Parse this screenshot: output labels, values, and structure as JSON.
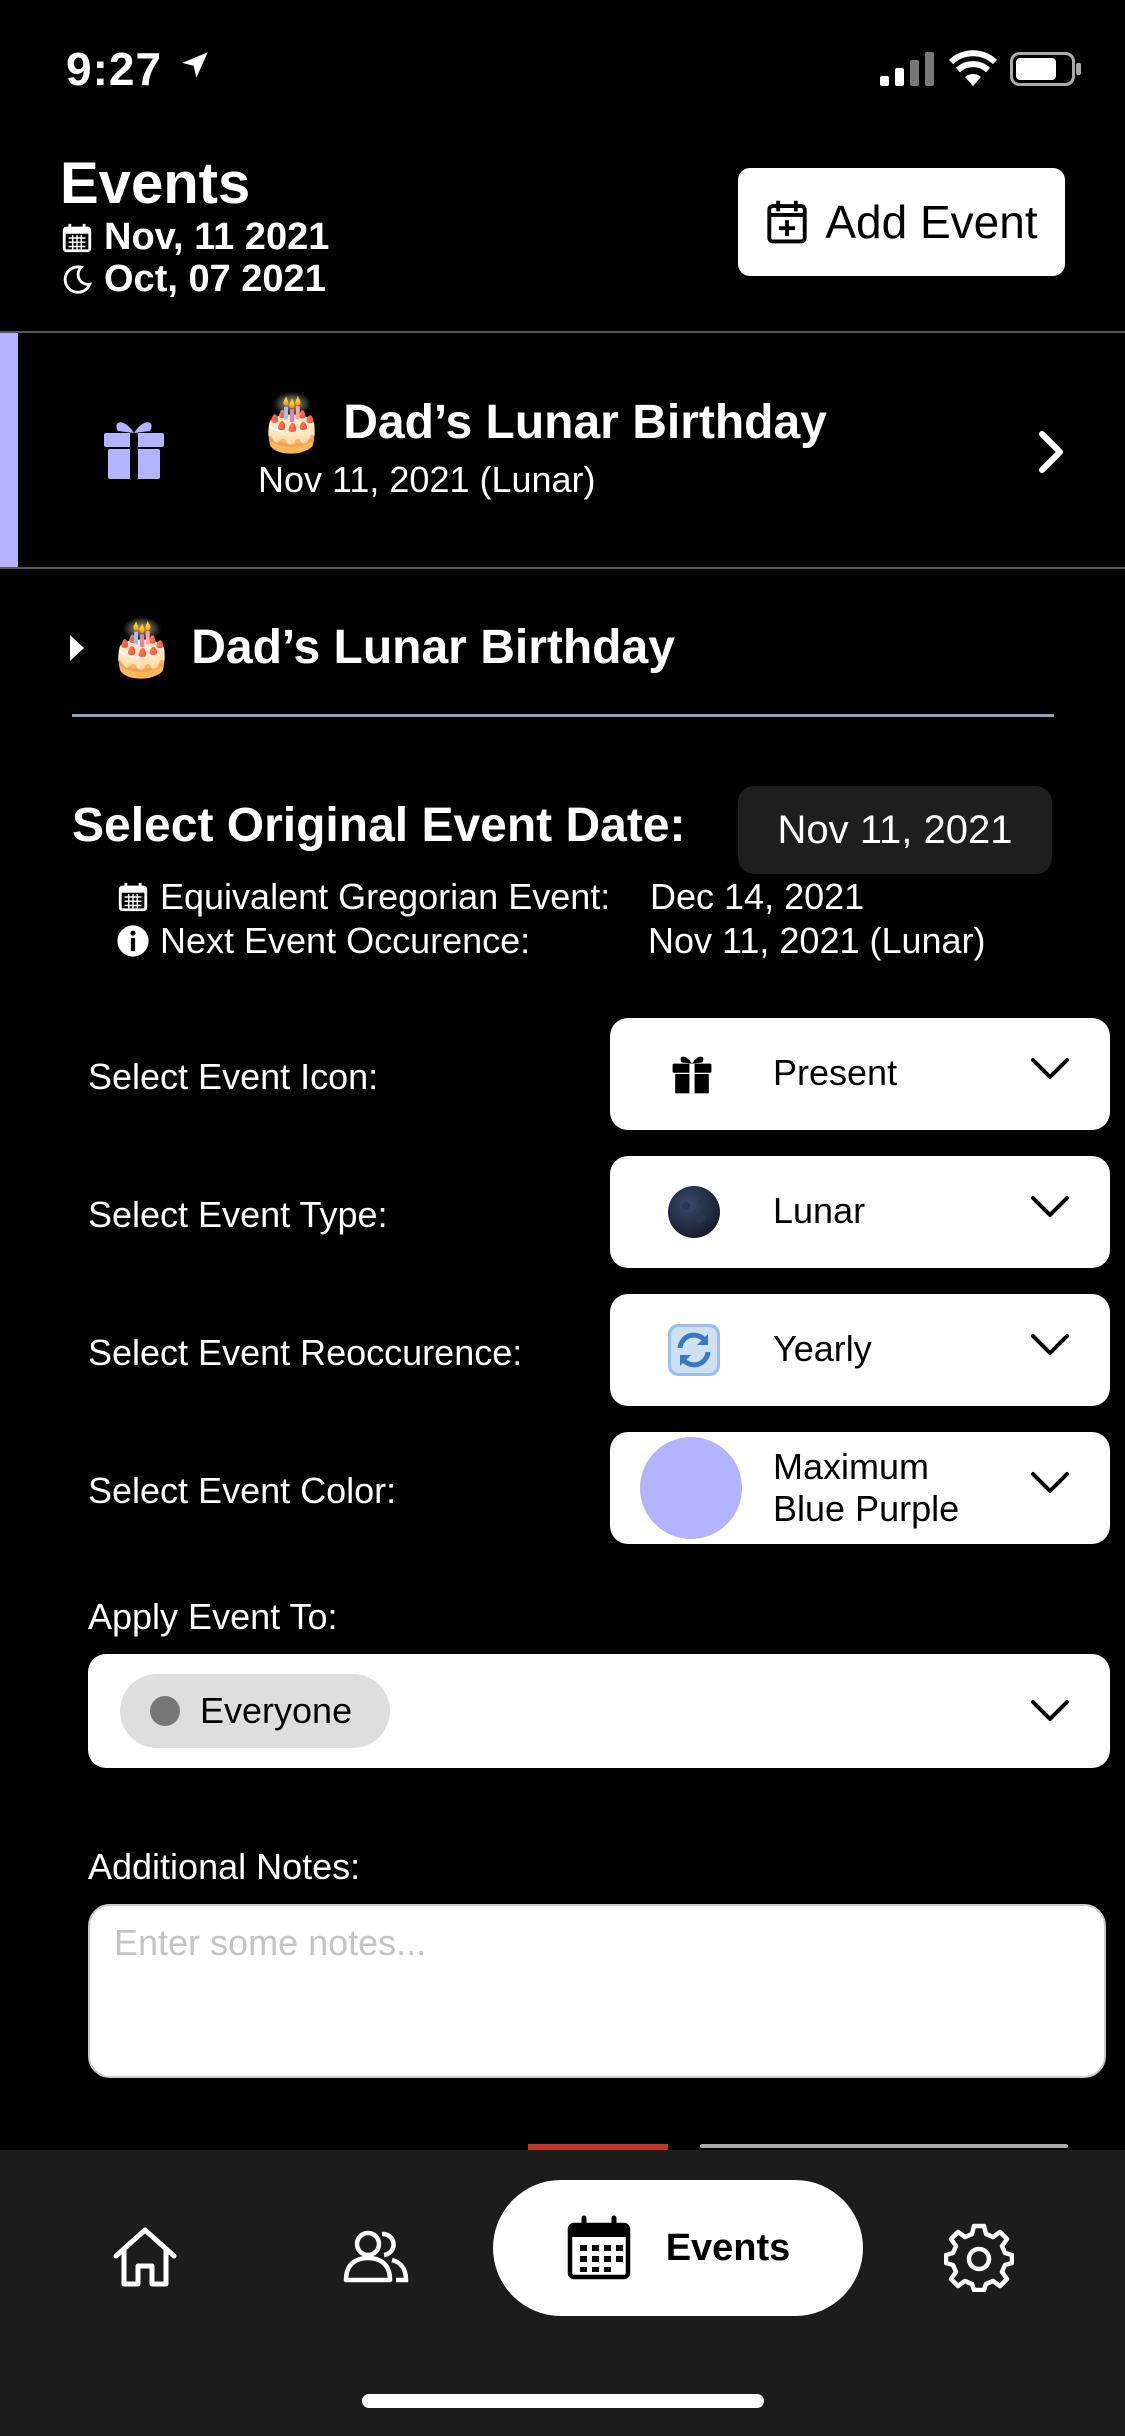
{
  "status": {
    "time": "9:27"
  },
  "header": {
    "title": "Events",
    "gregorian_date": "Nov, 11 2021",
    "lunar_date": "Oct, 07 2021",
    "add_button": "Add Event"
  },
  "event_row": {
    "emoji": "🎂",
    "title": "Dad’s Lunar Birthday",
    "subtitle": "Nov 11, 2021 (Lunar)",
    "accent_color": "#b3b3ff"
  },
  "detail": {
    "heading_emoji": "🎂",
    "heading": "Dad’s Lunar Birthday",
    "original_date_label": "Select Original Event Date:",
    "original_date_value": "Nov 11, 2021",
    "equiv_label": "Equivalent Gregorian Event:",
    "equiv_value": "Dec 14, 2021",
    "next_label": "Next Event Occurence:",
    "next_value": "Nov 11, 2021 (Lunar)",
    "icon_label": "Select Event Icon:",
    "icon_value": "Present",
    "type_label": "Select Event Type:",
    "type_value": "Lunar",
    "reoc_label": "Select Event Reoccurence:",
    "reoc_value": "Yearly",
    "color_label": "Select Event Color:",
    "color_value_line1": "Maximum",
    "color_value_line2": "Blue Purple",
    "color_hex": "#b3b3ff",
    "apply_label": "Apply Event To:",
    "apply_value": "Everyone",
    "notes_label": "Additional Notes:",
    "notes_placeholder": "Enter some notes..."
  },
  "tabbar": {
    "tabs": [
      {
        "icon": "home-icon"
      },
      {
        "icon": "people-icon"
      },
      {
        "icon": "calendar-icon",
        "label": "Events",
        "active": true
      },
      {
        "icon": "gear-icon"
      }
    ]
  }
}
